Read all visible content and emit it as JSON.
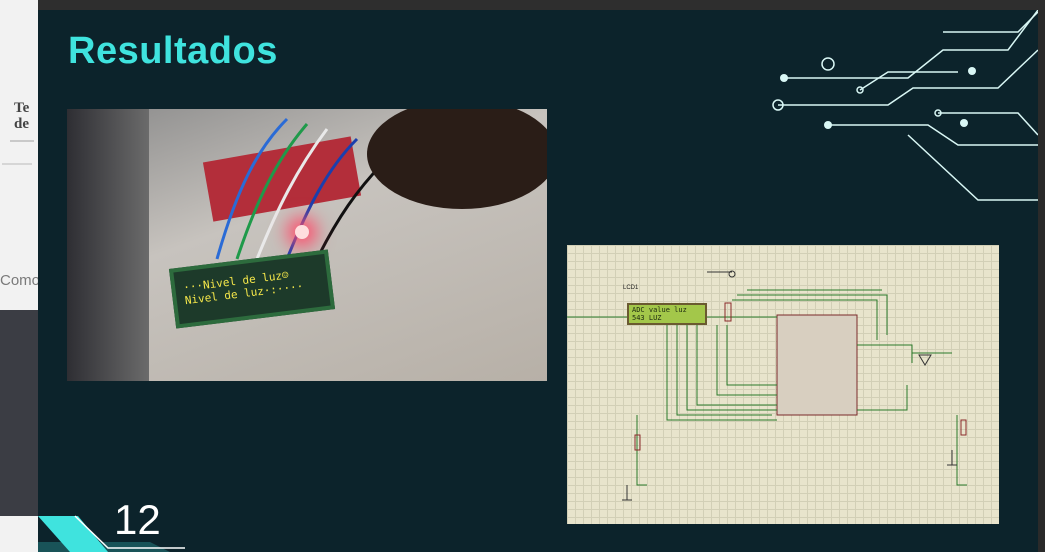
{
  "slide": {
    "title": "Resultados",
    "page_number": "12"
  },
  "photo": {
    "lcd_line1": "···Nivel de luz☺",
    "lcd_line2": "Nivel de luz·:····"
  },
  "schematic": {
    "lcd_label": "LCD1",
    "lcd_line1": "ADC value luz",
    "lcd_line2": "   543  LUZ"
  },
  "background_doc": {
    "heading": "Te de",
    "text": "Como"
  },
  "colors": {
    "slide_bg": "#0c232b",
    "accent": "#3fe3de",
    "text_white": "#ffffff"
  }
}
